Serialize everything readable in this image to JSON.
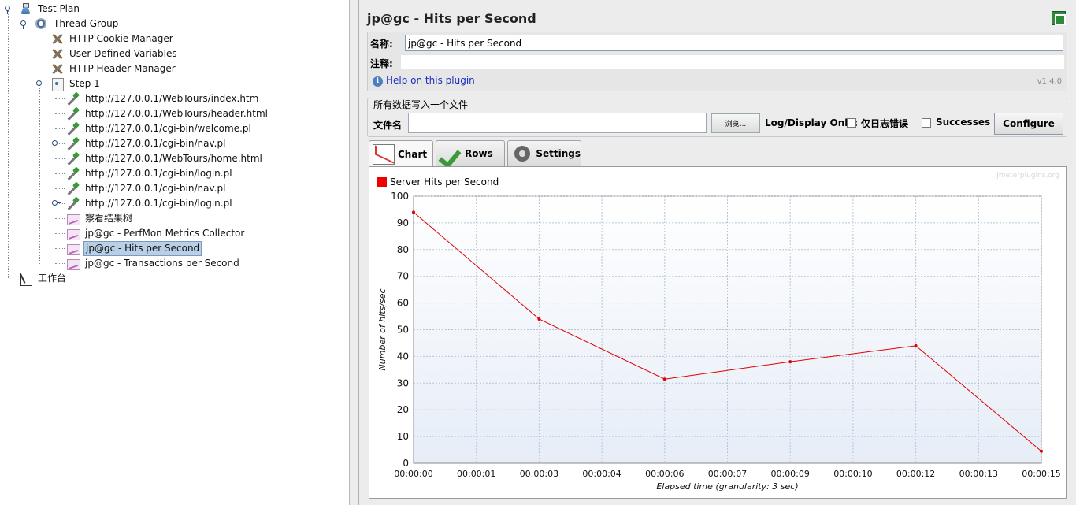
{
  "tree": {
    "items": [
      {
        "label": "Test Plan",
        "icon": "flask-icon"
      },
      {
        "label": "Thread Group",
        "icon": "gear-icon"
      },
      {
        "label": "HTTP Cookie Manager",
        "icon": "wrench-icon"
      },
      {
        "label": "User Defined Variables",
        "icon": "wrench-icon"
      },
      {
        "label": "HTTP Header Manager",
        "icon": "wrench-icon"
      },
      {
        "label": "Step 1",
        "icon": "step-icon"
      },
      {
        "label": "http://127.0.0.1/WebTours/index.htm",
        "icon": "pipette-icon"
      },
      {
        "label": "http://127.0.0.1/WebTours/header.html",
        "icon": "pipette-icon"
      },
      {
        "label": "http://127.0.0.1/cgi-bin/welcome.pl",
        "icon": "pipette-icon"
      },
      {
        "label": "http://127.0.0.1/cgi-bin/nav.pl",
        "icon": "pipette-icon"
      },
      {
        "label": "http://127.0.0.1/WebTours/home.html",
        "icon": "pipette-icon"
      },
      {
        "label": "http://127.0.0.1/cgi-bin/login.pl",
        "icon": "pipette-icon"
      },
      {
        "label": "http://127.0.0.1/cgi-bin/nav.pl",
        "icon": "pipette-icon"
      },
      {
        "label": "http://127.0.0.1/cgi-bin/login.pl",
        "icon": "pipette-icon"
      },
      {
        "label": "察看结果树",
        "icon": "listener-icon"
      },
      {
        "label": "jp@gc - PerfMon Metrics Collector",
        "icon": "listener-icon"
      },
      {
        "label": "jp@gc - Hits per Second",
        "icon": "listener-icon",
        "selected": true
      },
      {
        "label": "jp@gc - Transactions per Second",
        "icon": "listener-icon"
      },
      {
        "label": "工作台",
        "icon": "workbench-icon"
      }
    ]
  },
  "panel": {
    "title": "jp@gc - Hits per Second",
    "name_label": "名称:",
    "name_value": "jp@gc - Hits per Second",
    "comment_label": "注释:",
    "comment_value": "",
    "help_link": "Help on this plugin",
    "version": "v1.4.0"
  },
  "file_section": {
    "title": "所有数据写入一个文件",
    "file_label": "文件名",
    "file_value": "",
    "browse_label": "浏览...",
    "log_display_label": "Log/Display Only:",
    "errors_label": "仅日志错误",
    "successes_label": "Successes",
    "configure_label": "Configure"
  },
  "tabs": [
    {
      "label": "Chart",
      "icon": "chart-icon",
      "active": true
    },
    {
      "label": "Rows",
      "icon": "checkmark-icon",
      "active": false
    },
    {
      "label": "Settings",
      "icon": "gear-icon",
      "active": false
    }
  ],
  "chart_data": {
    "type": "line",
    "watermark": "jmeterplugins.org",
    "xlabel": "Elapsed time (granularity: 3 sec)",
    "ylabel": "Number of hits/sec",
    "ylim": [
      0,
      100
    ],
    "yticks": [
      0,
      10,
      20,
      30,
      40,
      50,
      60,
      70,
      80,
      90,
      100
    ],
    "xticks": [
      "00:00:00",
      "00:00:01",
      "00:00:03",
      "00:00:04",
      "00:00:06",
      "00:00:07",
      "00:00:09",
      "00:00:10",
      "00:00:12",
      "00:00:13",
      "00:00:15"
    ],
    "grid": true,
    "legend_position": "top-left",
    "series": [
      {
        "name": "Server Hits per Second",
        "color": "#e00000",
        "x_index": [
          0,
          2,
          4,
          6,
          8,
          10
        ],
        "values": [
          94,
          54,
          31.5,
          38,
          44,
          4.5
        ]
      }
    ]
  }
}
